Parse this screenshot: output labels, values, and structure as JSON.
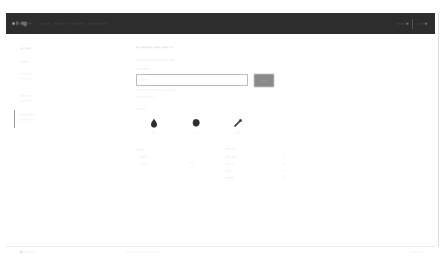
{
  "header": {
    "brand": "●  t··ng ··",
    "nav": [
      "··· ···",
      "··· ····",
      "·· ·· ······",
      "···· ··· ·····"
    ],
    "right_items": [
      "······· ▾",
      "· ··· ▾"
    ]
  },
  "sidebar": {
    "title": "·· ····",
    "items": [
      {
        "l1": "········",
        "l2": ""
      },
      {
        "l1": "·· ···· ···",
        "l2": "·· ·······"
      },
      {
        "l1": "··· ·· ···",
        "l2": "··· ·· ····"
      },
      {
        "l1": "·· ·········· ·",
        "l2": "··· ······"
      }
    ]
  },
  "main": {
    "title": "·· ······· ···· ···· ··",
    "subtitle": "····· ······ ········ ·· ··· ····",
    "field_label": "···· ·······",
    "field_value": "·····",
    "go_label": "····",
    "hint": "······· ·· ··········· ··· · ······",
    "secondary_link": "·· ···· · ····· ··",
    "options_label": "········",
    "modes": [
      {
        "icon": "drop-icon",
        "caption": "····"
      },
      {
        "icon": "blob-icon",
        "caption": "·· ··"
      },
      {
        "icon": "tool-icon",
        "caption": "·····"
      }
    ],
    "list_heading": "·······",
    "list_items": [
      "······",
      "··· ···"
    ],
    "list_link": "······",
    "stats_heading": "···· ···",
    "stats": [
      {
        "label": "···· ····",
        "value": "··"
      },
      {
        "label": "··· ···",
        "value": "··"
      },
      {
        "label": "·····",
        "value": "··"
      },
      {
        "label": "·······",
        "value": "··"
      }
    ]
  },
  "footer": {
    "left": "● ···· ···· ·",
    "center": "··· ········ ···· ·· ···· ····",
    "right": "······· · ····"
  }
}
